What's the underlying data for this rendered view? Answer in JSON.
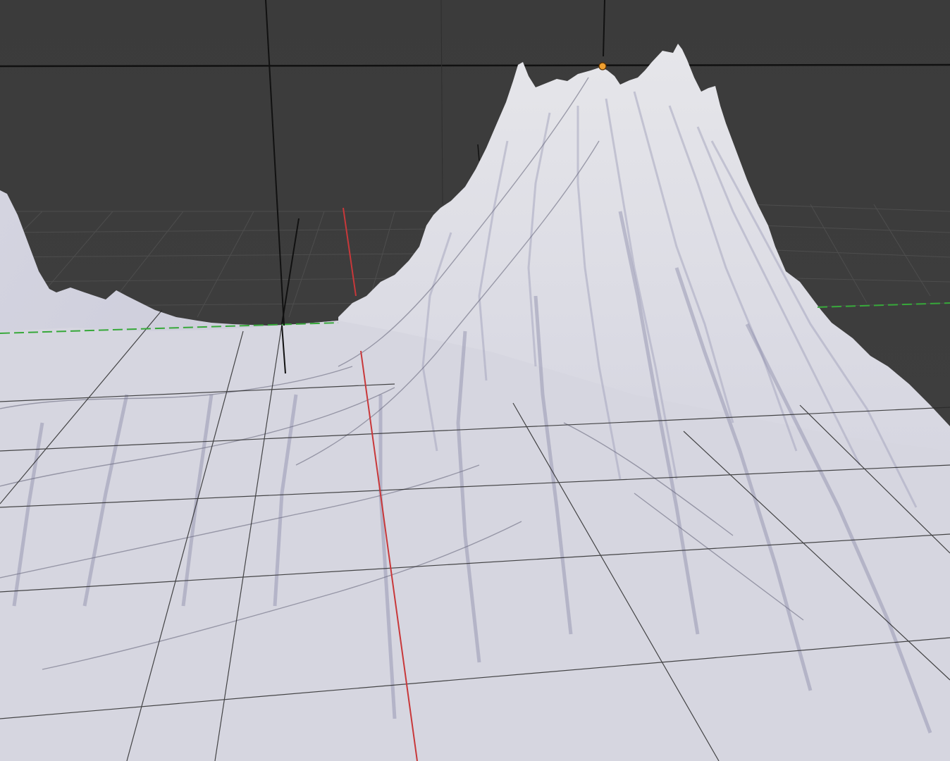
{
  "viewport": {
    "background_color": "#3d3d3d",
    "terrain_color": "#dcdce6",
    "terrain_shadow_color": "#9a9ab4",
    "grid_color": "#2a2a2a",
    "x_axis_color": "#c8383a",
    "y_axis_color": "#37a83a",
    "selection_color": "#f0a030",
    "icons": [
      "lamp-origin-icon",
      "selected-vertex-icon"
    ]
  }
}
